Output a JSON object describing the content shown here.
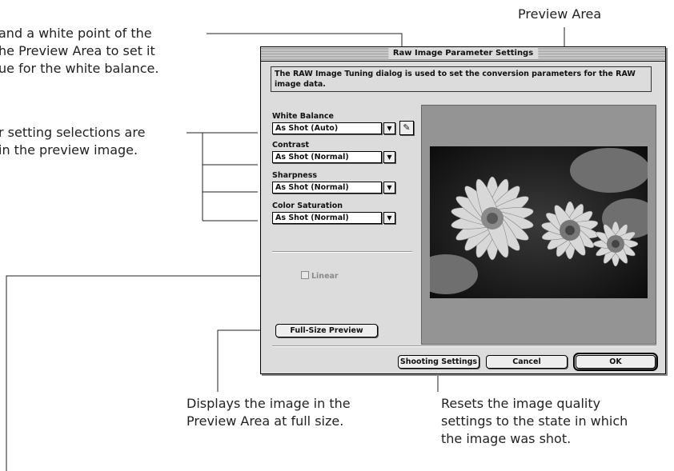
{
  "annotations": {
    "white_point": [
      "and a white point of the",
      "he Preview Area to set it",
      "ue for the white balance."
    ],
    "settings": [
      "r setting selections are",
      "in the preview image."
    ],
    "preview_area": "Preview Area",
    "full_size": [
      "Displays the image in the",
      "Preview Area at full size."
    ],
    "shooting": [
      "Resets the image quality",
      "settings to the state in which",
      "the image was shot."
    ]
  },
  "dialog": {
    "title": "Raw Image Parameter Settings",
    "description": "The RAW Image Tuning dialog is used to set the conversion parameters for the RAW image data.",
    "white_balance": {
      "label": "White Balance",
      "value": "As Shot (Auto)"
    },
    "contrast": {
      "label": "Contrast",
      "value": "As Shot (Normal)"
    },
    "sharpness": {
      "label": "Sharpness",
      "value": "As Shot (Normal)"
    },
    "saturation": {
      "label": "Color Saturation",
      "value": "As Shot (Normal)"
    },
    "linear": {
      "label": "Linear",
      "checked": false,
      "enabled": false
    },
    "buttons": {
      "full_size": "Full-Size Preview",
      "shooting": "Shooting Settings",
      "cancel": "Cancel",
      "ok": "OK"
    },
    "icons": {
      "dropdown": "chevron-down-icon",
      "picker": "eyedropper-icon"
    }
  }
}
